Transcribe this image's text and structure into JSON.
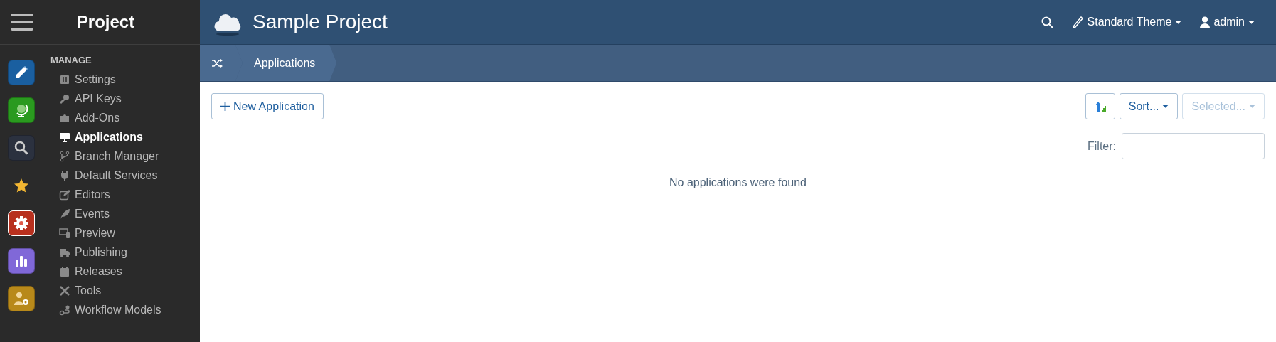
{
  "sidebar": {
    "title": "Project",
    "rail": [
      {
        "kind": "pencil",
        "color": "#1a5fa0",
        "selected": false
      },
      {
        "kind": "globe",
        "color": "#2a9a1f",
        "selected": false
      },
      {
        "kind": "search",
        "color": "#2b313f",
        "selected": false
      },
      {
        "kind": "star",
        "selected": false
      },
      {
        "kind": "gear",
        "color": "#b8301e",
        "selected": true
      },
      {
        "kind": "chart",
        "color": "#8068d8",
        "selected": false
      },
      {
        "kind": "usergear",
        "color": "#b8891a",
        "selected": false
      }
    ],
    "section": "MANAGE",
    "items": [
      {
        "label": "Settings",
        "kind": "settings",
        "selected": false
      },
      {
        "label": "API Keys",
        "kind": "key",
        "selected": false
      },
      {
        "label": "Add-Ons",
        "kind": "puzzle",
        "selected": false
      },
      {
        "label": "Applications",
        "kind": "monitor",
        "selected": true
      },
      {
        "label": "Branch Manager",
        "kind": "branch",
        "selected": false
      },
      {
        "label": "Default Services",
        "kind": "plug",
        "selected": false
      },
      {
        "label": "Editors",
        "kind": "edit",
        "selected": false
      },
      {
        "label": "Events",
        "kind": "feather",
        "selected": false
      },
      {
        "label": "Preview",
        "kind": "devices",
        "selected": false
      },
      {
        "label": "Publishing",
        "kind": "truck",
        "selected": false
      },
      {
        "label": "Releases",
        "kind": "calendar",
        "selected": false
      },
      {
        "label": "Tools",
        "kind": "tools",
        "selected": false
      },
      {
        "label": "Workflow Models",
        "kind": "workflow",
        "selected": false
      }
    ]
  },
  "header": {
    "title": "Sample Project",
    "theme": "Standard Theme",
    "user": "admin"
  },
  "breadcrumb": [
    {
      "label": "Applications"
    }
  ],
  "toolbar": {
    "new_button": "New Application",
    "sort_button": "Sort...",
    "selected_button": {
      "label": "Selected...",
      "disabled": true
    },
    "filter": {
      "label": "Filter:"
    }
  },
  "message": "No applications were found"
}
